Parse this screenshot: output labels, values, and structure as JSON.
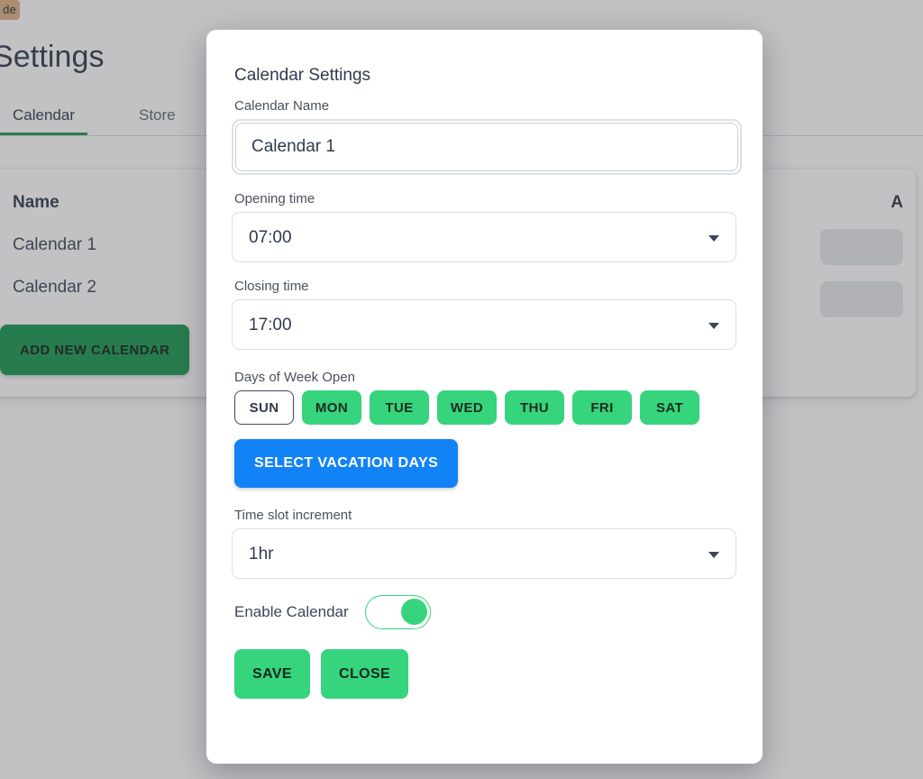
{
  "page": {
    "badge_text": "de",
    "title": "Settings",
    "tabs": [
      {
        "label": "Calendar",
        "active": true
      },
      {
        "label": "Store",
        "active": false
      }
    ],
    "table": {
      "col_name": "Name",
      "col_actions": "A",
      "rows": [
        {
          "name": "Calendar 1",
          "action": ""
        },
        {
          "name": "Calendar 2",
          "action": ""
        }
      ]
    },
    "add_calendar_label": "ADD NEW CALENDAR"
  },
  "modal": {
    "title": "Calendar Settings",
    "name_field": {
      "label": "Calendar Name",
      "value": "Calendar 1",
      "placeholder": "Calendar Name"
    },
    "opening_time": {
      "label": "Opening time",
      "value": "07:00"
    },
    "closing_time": {
      "label": "Closing time",
      "value": "17:00"
    },
    "days_label": "Days of Week Open",
    "days": [
      {
        "label": "SUN",
        "selected": false
      },
      {
        "label": "MON",
        "selected": true
      },
      {
        "label": "TUE",
        "selected": true
      },
      {
        "label": "WED",
        "selected": true
      },
      {
        "label": "THU",
        "selected": true
      },
      {
        "label": "FRI",
        "selected": true
      },
      {
        "label": "SAT",
        "selected": true
      }
    ],
    "vacation_label": "SELECT VACATION DAYS",
    "time_slot": {
      "label": "Time slot increment",
      "value": "1hr"
    },
    "enable_calendar": {
      "label": "Enable Calendar",
      "on": true
    },
    "save_label": "SAVE",
    "close_label": "CLOSE"
  },
  "colors": {
    "green_pill": "#35d47d",
    "green_dark": "#199750",
    "blue": "#1283f7",
    "text_dark": "#2f3b4d",
    "badge_tan": "#dfb183",
    "tab_underline": "#1f9a4d"
  }
}
